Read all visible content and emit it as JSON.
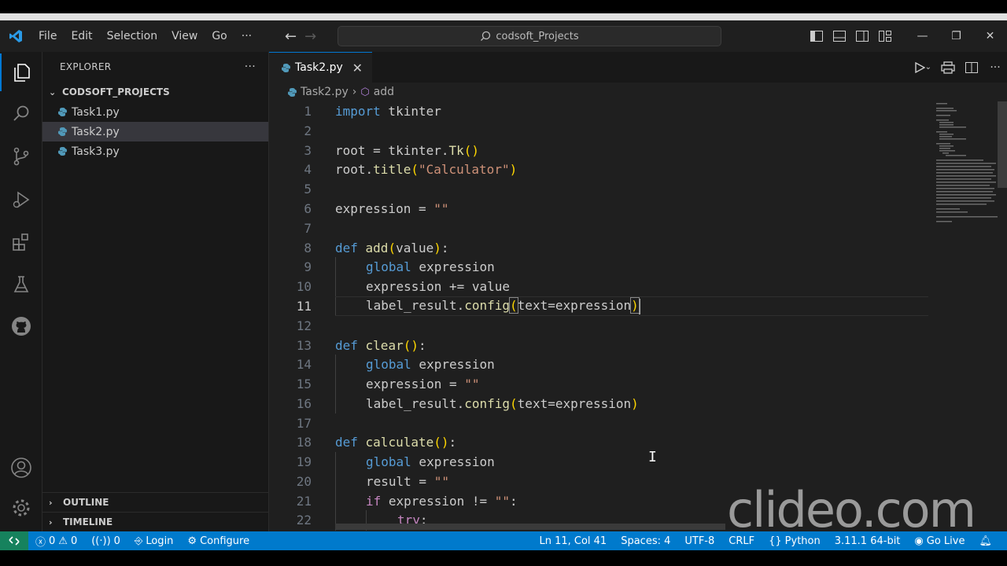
{
  "menu": {
    "file": "File",
    "edit": "Edit",
    "selection": "Selection",
    "view": "View",
    "go": "Go",
    "more": "···"
  },
  "search": {
    "text": "codsoft_Projects"
  },
  "explorer": {
    "header": "EXPLORER",
    "more": "···",
    "project": "CODSOFT_PROJECTS",
    "files": [
      "Task1.py",
      "Task2.py",
      "Task3.py"
    ],
    "outline": "OUTLINE",
    "timeline": "TIMELINE"
  },
  "tab": {
    "label": "Task2.py",
    "close": "✕"
  },
  "breadcrumb": {
    "file": "Task2.py",
    "symbol": "add"
  },
  "code": {
    "l1": {
      "n": "1"
    },
    "l2": {
      "n": "2"
    },
    "l3": {
      "n": "3"
    },
    "l4": {
      "n": "4"
    },
    "l5": {
      "n": "5"
    },
    "l6": {
      "n": "6"
    },
    "l7": {
      "n": "7"
    },
    "l8": {
      "n": "8"
    },
    "l9": {
      "n": "9"
    },
    "l10": {
      "n": "10"
    },
    "l11": {
      "n": "11"
    },
    "l12": {
      "n": "12"
    },
    "l13": {
      "n": "13"
    },
    "l14": {
      "n": "14"
    },
    "l15": {
      "n": "15"
    },
    "l16": {
      "n": "16"
    },
    "l17": {
      "n": "17"
    },
    "l18": {
      "n": "18"
    },
    "l19": {
      "n": "19"
    },
    "l20": {
      "n": "20"
    },
    "l21": {
      "n": "21"
    },
    "l22": {
      "n": "22"
    },
    "import": "import",
    "tkinter": " tkinter",
    "root_assign": "root = tkinter.",
    "tk": "Tk",
    "unit_parens": "()",
    "root_title": "root.",
    "title": "title",
    "calc_str": "\"Calculator\"",
    "expr_assign": "expression = ",
    "empty_str": "\"\"",
    "def": "def",
    "add": " add",
    "value_param": "value",
    "colon": ":",
    "global": "global",
    "expression": " expression",
    "expr_plus": "expression += value",
    "label_config": "label_result.",
    "config": "config",
    "text_expr": "text=expression",
    "clear": " clear",
    "calculate": " calculate",
    "result_assign": "result = ",
    "if": "if",
    "neq": " expression != ",
    "try": "try",
    "lparen": "(",
    "rparen": ")"
  },
  "status": {
    "errors": "0",
    "warnings": "0",
    "ports": "0",
    "login": "Login",
    "configure": "Configure",
    "position": "Ln 11, Col 41",
    "spaces": "Spaces: 4",
    "encoding": "UTF-8",
    "eol": "CRLF",
    "language": "Python",
    "interpreter": "3.11.1 64-bit",
    "golive": "Go Live"
  },
  "watermark": "clideo.com",
  "colors": {
    "accent": "#007acc",
    "keyword": "#569cd6",
    "function": "#dcdcaa",
    "string": "#ce9178",
    "control": "#c586c0"
  }
}
